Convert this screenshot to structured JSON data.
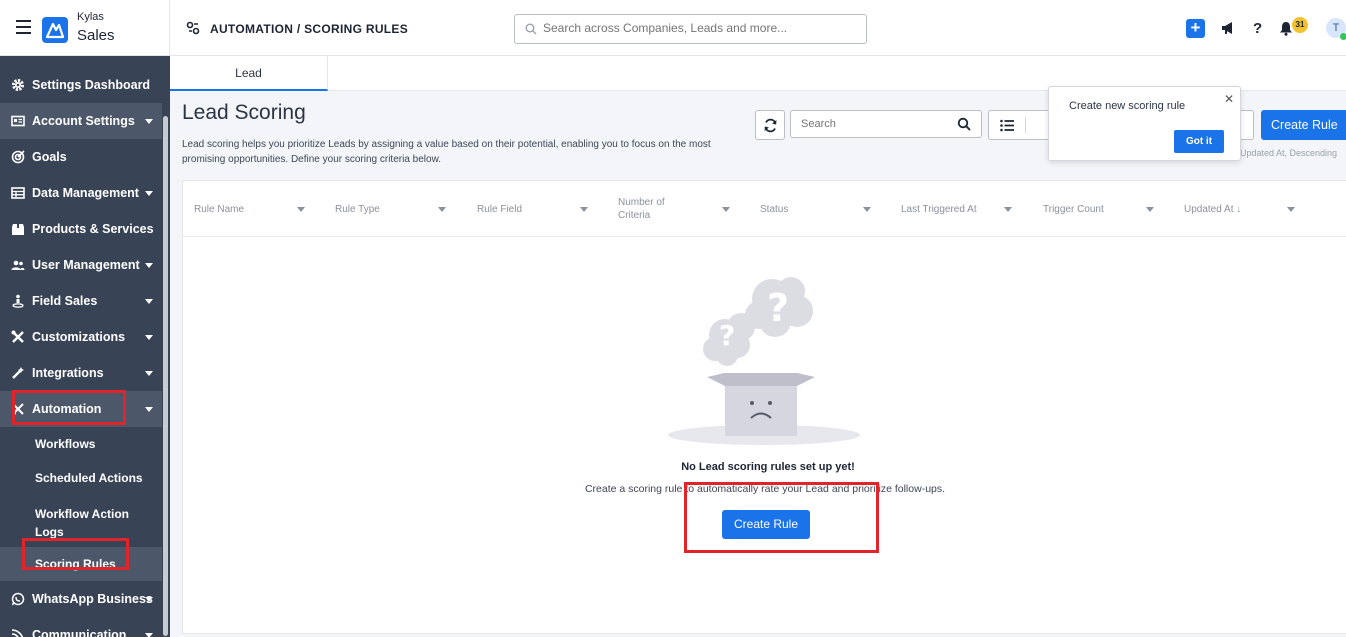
{
  "app": {
    "brand_small": "Kylas",
    "brand_big": "Sales"
  },
  "header": {
    "breadcrumb": "AUTOMATION / SCORING RULES",
    "search_placeholder": "Search across Companies, Leads and more...",
    "notification_count": "31",
    "avatar_initial": "T"
  },
  "sidebar": {
    "items": [
      {
        "label": "Settings Dashboard",
        "icon": "gear-icon",
        "expandable": false
      },
      {
        "label": "Account Settings",
        "icon": "account-card-icon",
        "expandable": true
      },
      {
        "label": "Goals",
        "icon": "target-icon",
        "expandable": false
      },
      {
        "label": "Data Management",
        "icon": "table-icon",
        "expandable": true
      },
      {
        "label": "Products & Services",
        "icon": "box-icon",
        "expandable": false
      },
      {
        "label": "User Management",
        "icon": "users-icon",
        "expandable": true
      },
      {
        "label": "Field Sales",
        "icon": "person-pin-icon",
        "expandable": true
      },
      {
        "label": "Customizations",
        "icon": "tools-icon",
        "expandable": true
      },
      {
        "label": "Integrations",
        "icon": "wand-icon",
        "expandable": true
      },
      {
        "label": "Automation",
        "icon": "automation-icon",
        "expandable": true
      },
      {
        "label": "WhatsApp Business",
        "icon": "whatsapp-icon",
        "expandable": true
      },
      {
        "label": "Communication",
        "icon": "broadcast-icon",
        "expandable": true
      }
    ],
    "automation_sub": [
      "Workflows",
      "Scheduled Actions",
      "Workflow Action Logs",
      "Scoring Rules"
    ]
  },
  "tabs": [
    "Lead"
  ],
  "page": {
    "title": "Lead Scoring",
    "description": "Lead scoring helps you prioritize Leads by assigning a value based on their potential, enabling you to focus on the most promising opportunities. Define your scoring criteria below.",
    "search_placeholder": "Search",
    "create_rule_label": "Create Rule",
    "sort_info": "Updated At, Descending"
  },
  "popover": {
    "text": "Create new scoring rule",
    "button": "Got it",
    "close": "✕"
  },
  "table": {
    "columns": [
      "Rule Name",
      "Rule Type",
      "Rule Field",
      "Number of Criteria",
      "Status",
      "Last Triggered At",
      "Trigger Count",
      "Updated At ↓"
    ]
  },
  "empty_state": {
    "title": "No Lead scoring rules set up yet!",
    "subtitle": "Create a scoring rule to automatically rate your Lead and prioritize follow-ups.",
    "button": "Create Rule"
  },
  "colors": {
    "accent": "#1a73e8",
    "sidebar": "#384456",
    "highlight": "#e0242a"
  }
}
